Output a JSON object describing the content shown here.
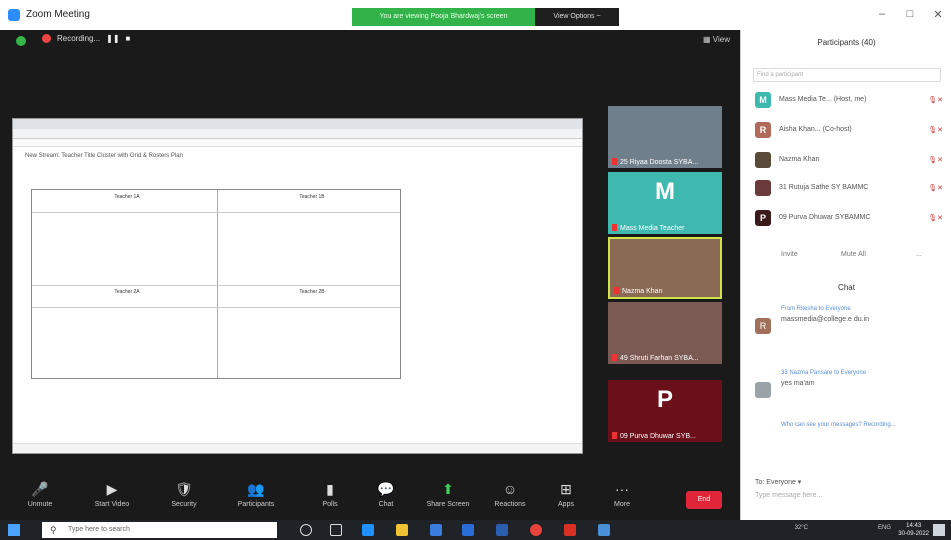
{
  "window": {
    "title": "Zoom Meeting",
    "share_banner": "You are viewing Pooja Bhardwaj's screen",
    "view_options": "View Options ~",
    "minimize": "–",
    "maximize": "□",
    "close": "✕"
  },
  "meeting": {
    "recording_label": "Recording...",
    "pause": "❚❚",
    "stop": "■",
    "view_label": "▦ View"
  },
  "shared_screen": {
    "sheet_title": "New Stream: Teacher Title Cluster with Grid & Rosters Plan",
    "table_headings": [
      "Teacher 1A",
      "Teacher 1B",
      "Teacher 2A",
      "Teacher 2B"
    ]
  },
  "gallery": [
    {
      "name": "25 Riyaa Doosta SYBA...",
      "initial": "",
      "bg": "#6f7f8c"
    },
    {
      "name": "Mass Media Teacher",
      "initial": "M",
      "bg": "#3fb8b0"
    },
    {
      "name": "Nazma Khan",
      "initial": "",
      "bg": "#8a6a55"
    },
    {
      "name": "49 Shruti Farhan SYBA...",
      "initial": "",
      "bg": "#7a5a52"
    },
    {
      "name": "09 Purva Dhuwar SYB...",
      "initial": "P",
      "bg": "#6b0f1a"
    }
  ],
  "toolbar": {
    "items": [
      {
        "icon": "🎤",
        "label": "Unmute"
      },
      {
        "icon": "▶",
        "label": "Start Video"
      },
      {
        "icon": "🛡",
        "label": "Security"
      },
      {
        "icon": "👥",
        "label": "Participants"
      },
      {
        "icon": "▮",
        "label": "Polls"
      },
      {
        "icon": "💬",
        "label": "Chat"
      },
      {
        "icon": "⬆",
        "label": "Share Screen"
      },
      {
        "icon": "☺",
        "label": "Reactions"
      },
      {
        "icon": "⊞",
        "label": "Apps"
      },
      {
        "icon": "···",
        "label": "More"
      }
    ],
    "participants_count": "40",
    "end_label": "End"
  },
  "participants_panel": {
    "title": "Participants (40)",
    "search_placeholder": "Find a participant",
    "rows": [
      {
        "initial": "M",
        "name": "Mass Media Te... (Host, me)",
        "color": "#3fb8b0"
      },
      {
        "initial": "R",
        "name": "Aisha Khan... (Co-host)",
        "color": "#b06a5a"
      },
      {
        "initial": "",
        "name": "Nazma Khan",
        "color": "#5a4a3a"
      },
      {
        "initial": "",
        "name": "31 Rutuja Sathe SY BAMMC",
        "color": "#6a3a3a"
      },
      {
        "initial": "P",
        "name": "09 Purva Dhuwar SYBAMMC",
        "color": "#3a1a1a"
      }
    ],
    "invite_label": "Invite",
    "mute_all_label": "Mute All",
    "more_label": "..."
  },
  "chat": {
    "title": "Chat",
    "messages": [
      {
        "meta": "From Ritesha to Everyone",
        "initial": "R",
        "text": "massmedia@college.e du.in"
      },
      {
        "meta": "33 Nazma Pansare to Everyone",
        "initial": "",
        "text": "yes ma'am"
      }
    ],
    "notice": "Who can see your messages? Recording...",
    "to_label": "To: Everyone ▾",
    "input_placeholder": "Type message here..."
  },
  "taskbar": {
    "search_placeholder": "Type here to search",
    "weather": "32°C",
    "lang": "ENG",
    "time": "14:43",
    "date": "30-09-2022"
  }
}
